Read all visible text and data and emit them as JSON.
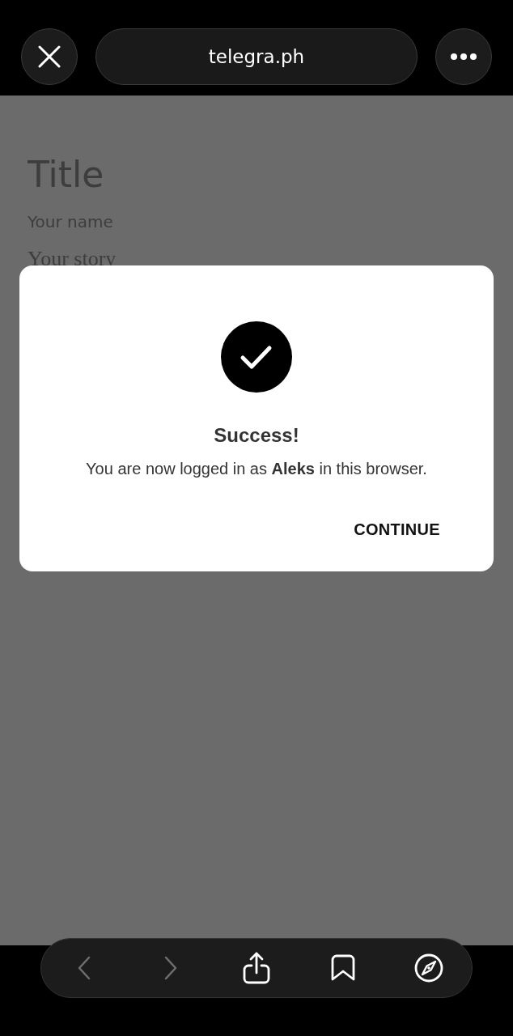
{
  "browser_bar": {
    "url": "telegra.ph"
  },
  "page": {
    "fields": [
      {
        "kind": "title",
        "placeholder": "Title"
      },
      {
        "kind": "author",
        "placeholder": "Your name"
      },
      {
        "kind": "story",
        "placeholder": "Your story"
      }
    ]
  },
  "dialog": {
    "title": "Success!",
    "message": "You are now logged in as **Aleks** in this browser.",
    "button": "CONTINUE"
  },
  "toolbar": {
    "items": [
      {
        "kind": "back",
        "disabled": true
      },
      {
        "kind": "forward",
        "disabled": true
      },
      {
        "kind": "share",
        "disabled": false
      },
      {
        "kind": "bookmarks",
        "disabled": false
      },
      {
        "kind": "compass",
        "disabled": false
      }
    ]
  }
}
